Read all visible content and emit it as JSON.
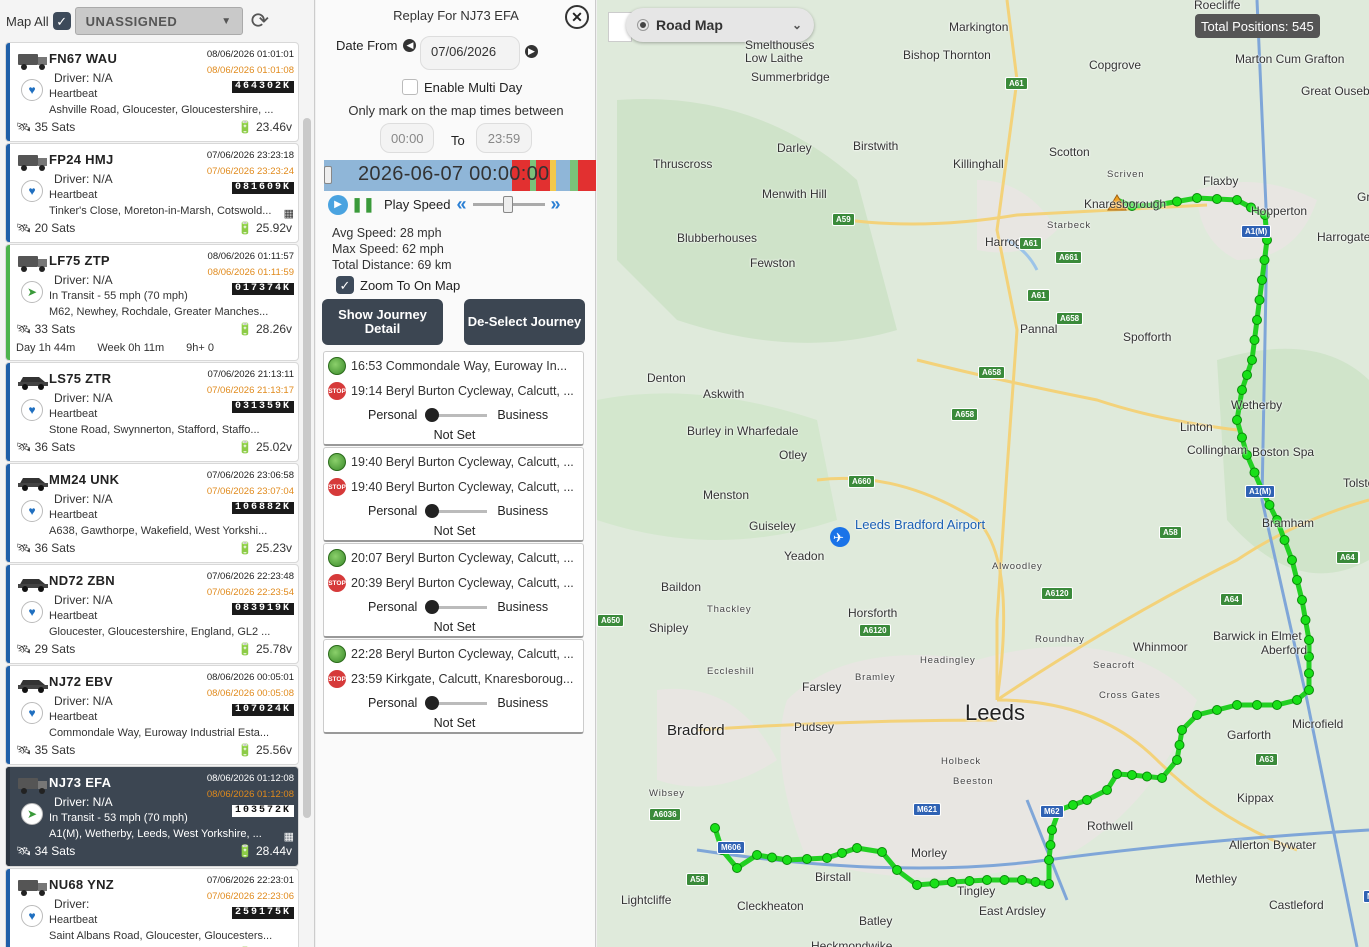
{
  "header": {
    "map_all_label": "Map All",
    "group_dropdown": "UNASSIGNED",
    "refresh_icon": "refresh-icon"
  },
  "vehicles": [
    {
      "reg": "FN67 WAU",
      "dt1": "08/06/2026 01:01:01",
      "dt2": "08/06/2026 01:01:08",
      "driver": "Driver: N/A",
      "odo": "464302K",
      "status": "Heartbeat",
      "addr": "Ashville Road, Gloucester, Gloucestershire, ...",
      "sats": "35 Sats",
      "volt": "23.46v",
      "icon": "truck-icon",
      "status_icon": "heartbeat-icon"
    },
    {
      "reg": "FP24 HMJ",
      "dt1": "07/06/2026 23:23:18",
      "dt2": "07/06/2026 23:23:24",
      "driver": "Driver: N/A",
      "odo": "081609K",
      "status": "Heartbeat",
      "addr": "Tinker's Close, Moreton-in-Marsh, Cotswold...",
      "sats": "20 Sats",
      "volt": "25.92v",
      "icon": "truck-icon",
      "status_icon": "heartbeat-icon",
      "trailer": true
    },
    {
      "reg": "LF75 ZTP",
      "dt1": "08/06/2026 01:11:57",
      "dt2": "08/06/2026 01:11:59",
      "driver": "Driver: N/A",
      "odo": "017374K",
      "status": "In Transit - 55 mph (70 mph)",
      "addr": "M62, Newhey, Rochdale, Greater Manches...",
      "sats": "33 Sats",
      "volt": "28.26v",
      "icon": "truck-icon",
      "status_icon": "transit-icon",
      "extra": [
        "Day 1h 44m",
        "Week 0h 11m",
        "9h+ 0"
      ]
    },
    {
      "reg": "LS75 ZTR",
      "dt1": "07/06/2026 21:13:11",
      "dt2": "07/06/2026 21:13:17",
      "driver": "Driver: N/A",
      "odo": "031359K",
      "status": "Heartbeat",
      "addr": "Stone Road, Swynnerton, Stafford, Staffo...",
      "sats": "36 Sats",
      "volt": "25.02v",
      "icon": "car-icon",
      "status_icon": "heartbeat-icon"
    },
    {
      "reg": "MM24 UNK",
      "dt1": "07/06/2026 23:06:58",
      "dt2": "07/06/2026 23:07:04",
      "driver": "Driver: N/A",
      "odo": "106882K",
      "status": "Heartbeat",
      "addr": "A638, Gawthorpe, Wakefield, West Yorkshi...",
      "sats": "36 Sats",
      "volt": "25.23v",
      "icon": "car-icon",
      "status_icon": "heartbeat-icon"
    },
    {
      "reg": "ND72 ZBN",
      "dt1": "07/06/2026 22:23:48",
      "dt2": "07/06/2026 22:23:54",
      "driver": "Driver: N/A",
      "odo": "083919K",
      "status": "Heartbeat",
      "addr": "Gloucester, Gloucestershire, England, GL2 ...",
      "sats": "29 Sats",
      "volt": "25.78v",
      "icon": "car-icon",
      "status_icon": "heartbeat-icon"
    },
    {
      "reg": "NJ72 EBV",
      "dt1": "08/06/2026 00:05:01",
      "dt2": "08/06/2026 00:05:08",
      "driver": "Driver: N/A",
      "odo": "107024K",
      "status": "Heartbeat",
      "addr": "Commondale Way, Euroway Industrial Esta...",
      "sats": "35 Sats",
      "volt": "25.56v",
      "icon": "car-icon",
      "status_icon": "heartbeat-icon"
    },
    {
      "reg": "NJ73 EFA",
      "dt1": "08/06/2026 01:12:08",
      "dt2": "08/06/2026 01:12:08",
      "driver": "Driver: N/A",
      "odo": "103572K",
      "status": "In Transit - 53 mph (70 mph)",
      "addr": "A1(M), Wetherby, Leeds, West Yorkshire, ...",
      "sats": "34 Sats",
      "volt": "28.44v",
      "icon": "truck-icon",
      "status_icon": "transit-icon",
      "trailer": true,
      "selected": true
    },
    {
      "reg": "NU68 YNZ",
      "dt1": "07/06/2026 22:23:01",
      "dt2": "07/06/2026 22:23:06",
      "driver": "Driver:",
      "odo": "259175K",
      "status": "Heartbeat",
      "addr": "Saint Albans Road, Gloucester, Gloucesters...",
      "sats": "36 Sats",
      "volt": "25.74v",
      "icon": "truck-icon",
      "status_icon": "heartbeat-icon"
    }
  ],
  "replay": {
    "title": "Replay For NJ73 EFA",
    "date_from_label": "Date From",
    "date_from": "07/06/2026",
    "enable_multi_day": "Enable Multi Day",
    "only_mark": "Only mark on the map times between",
    "time_from": "00:00",
    "to_label": "To",
    "time_to": "23:59",
    "timeline_time": "2026-06-07 00:00:00",
    "play_speed": "Play Speed",
    "avg_speed": "Avg Speed: 28 mph",
    "max_speed": "Max Speed: 62 mph",
    "total_distance": "Total Distance: 69 km",
    "zoom_to_map": "Zoom To On Map",
    "show_journey": "Show Journey Detail",
    "deselect_journey": "De-Select Journey"
  },
  "journeys": [
    {
      "start": "16:53 Commondale Way, Euroway In...",
      "end": "19:14 Beryl Burton Cycleway, Calcutt, ...",
      "personal": "Personal",
      "business": "Business",
      "class": "Not Set"
    },
    {
      "start": "19:40 Beryl Burton Cycleway, Calcutt, ...",
      "end": "19:40 Beryl Burton Cycleway, Calcutt, ...",
      "personal": "Personal",
      "business": "Business",
      "class": "Not Set"
    },
    {
      "start": "20:07 Beryl Burton Cycleway, Calcutt, ...",
      "end": "20:39 Beryl Burton Cycleway, Calcutt, ...",
      "personal": "Personal",
      "business": "Business",
      "class": "Not Set"
    },
    {
      "start": "22:28 Beryl Burton Cycleway, Calcutt, ...",
      "end": "23:59 Kirkgate, Calcutt, Knaresboroug...",
      "personal": "Personal",
      "business": "Business",
      "class": "Not Set"
    }
  ],
  "map": {
    "map_type": "Road Map",
    "total_positions": "Total Positions: 545",
    "places": [
      "Markington",
      "Roecliffe",
      "Smelthouses",
      "Low Laithe",
      "Bishop Thornton",
      "Summerbridge",
      "Copgrove",
      "Marton Cum Grafton",
      "Great Ouseburn",
      "Darley",
      "Birstwith",
      "Scotton",
      "Killinghall",
      "Thruscross",
      "Flaxby",
      "Scriven",
      "Menwith Hill",
      "Starbeck",
      "Knaresborough",
      "Harrogate",
      "Blubberhouses",
      "Fewston",
      "Hopperton",
      "Spofforth",
      "Pannal",
      "Denton",
      "Askwith",
      "Linton",
      "Wetherby",
      "Burley in Wharfedale",
      "Otley",
      "Collingham",
      "Boston Spa",
      "Menston",
      "Guiseley",
      "Leeds Bradford Airport",
      "Yeadon",
      "Bramham",
      "Alwoodley",
      "Baildon",
      "Thackley",
      "Horsforth",
      "Roundhay",
      "Shipley",
      "Headingley",
      "Whinmoor",
      "Barwick in Elmet",
      "Aberford",
      "Seacroft",
      "Eccleshill",
      "Bramley",
      "Farsley",
      "Cross Gates",
      "Pudsey",
      "Leeds",
      "Bradford",
      "Garforth",
      "Microfield",
      "Holbeck",
      "Beeston",
      "Wibsey",
      "Kippax",
      "Rothwell",
      "Morley",
      "Allerton Bywater",
      "Birstall",
      "Methley",
      "Tingley",
      "East Ardsley",
      "Lightcliffe",
      "Cleckheaton",
      "Batley",
      "Castleford",
      "Heckmondwike",
      "Tolston",
      "Greenhammerton",
      "Harrogate Road"
    ],
    "roads": [
      "A61",
      "A59",
      "A661",
      "A658",
      "A61",
      "A658",
      "A1(M)",
      "A58",
      "A64",
      "A64",
      "A6120",
      "A6120",
      "A658",
      "A660",
      "A1(M)",
      "A63",
      "A650",
      "M621",
      "M62",
      "M606",
      "A58",
      "M62",
      "A6036",
      "A64",
      "A61"
    ]
  }
}
